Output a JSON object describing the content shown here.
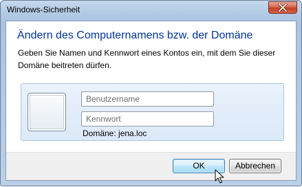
{
  "window": {
    "title": "Windows-Sicherheit",
    "close_icon": "close-icon"
  },
  "dialog": {
    "heading": "Ändern des Computernamens bzw. der Domäne",
    "description": "Geben Sie Namen und Kennwort eines Kontos ein, mit dem Sie dieser Domäne beitreten dürfen."
  },
  "credentials": {
    "user_tile_icon": "user-tile-icon",
    "username": {
      "value": "",
      "placeholder": "Benutzername"
    },
    "password": {
      "value": "",
      "placeholder": "Kennwort"
    },
    "domain_text": "Domäne: jena.loc"
  },
  "buttons": {
    "ok_label": "OK",
    "cancel_label": "Abbrechen"
  },
  "colors": {
    "heading": "#003399",
    "accent_blue": "#3c7fb1",
    "close_red": "#c33f22"
  }
}
